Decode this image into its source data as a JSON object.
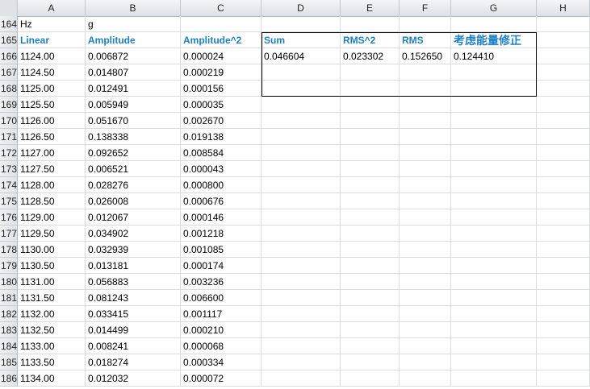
{
  "columns": [
    "A",
    "B",
    "C",
    "D",
    "E",
    "F",
    "G",
    "H"
  ],
  "rows": [
    {
      "num": "164",
      "a": "Hz",
      "b": "g",
      "c": "",
      "d": "",
      "e": "",
      "f": "",
      "g": "",
      "h": "",
      "hdr": false
    },
    {
      "num": "165",
      "a": "Linear",
      "b": "Amplitude",
      "c": "Amplitude^2",
      "d": "Sum",
      "e": "RMS^2",
      "f": "RMS",
      "g": "考虑能量修正",
      "h": "",
      "hdr": true
    },
    {
      "num": "166",
      "a": "1124.00",
      "b": "0.006872",
      "c": "0.000024",
      "d": "0.046604",
      "e": "0.023302",
      "f": "0.152650",
      "g": "0.124410",
      "h": "",
      "hdr": false
    },
    {
      "num": "167",
      "a": "1124.50",
      "b": "0.014807",
      "c": "0.000219",
      "d": "",
      "e": "",
      "f": "",
      "g": "",
      "h": "",
      "hdr": false
    },
    {
      "num": "168",
      "a": "1125.00",
      "b": "0.012491",
      "c": "0.000156",
      "d": "",
      "e": "",
      "f": "",
      "g": "",
      "h": "",
      "hdr": false
    },
    {
      "num": "169",
      "a": "1125.50",
      "b": "0.005949",
      "c": "0.000035",
      "d": "",
      "e": "",
      "f": "",
      "g": "",
      "h": "",
      "hdr": false
    },
    {
      "num": "170",
      "a": "1126.00",
      "b": "0.051670",
      "c": "0.002670",
      "d": "",
      "e": "",
      "f": "",
      "g": "",
      "h": "",
      "hdr": false
    },
    {
      "num": "171",
      "a": "1126.50",
      "b": "0.138338",
      "c": "0.019138",
      "d": "",
      "e": "",
      "f": "",
      "g": "",
      "h": "",
      "hdr": false
    },
    {
      "num": "172",
      "a": "1127.00",
      "b": "0.092652",
      "c": "0.008584",
      "d": "",
      "e": "",
      "f": "",
      "g": "",
      "h": "",
      "hdr": false
    },
    {
      "num": "173",
      "a": "1127.50",
      "b": "0.006521",
      "c": "0.000043",
      "d": "",
      "e": "",
      "f": "",
      "g": "",
      "h": "",
      "hdr": false
    },
    {
      "num": "174",
      "a": "1128.00",
      "b": "0.028276",
      "c": "0.000800",
      "d": "",
      "e": "",
      "f": "",
      "g": "",
      "h": "",
      "hdr": false
    },
    {
      "num": "175",
      "a": "1128.50",
      "b": "0.026008",
      "c": "0.000676",
      "d": "",
      "e": "",
      "f": "",
      "g": "",
      "h": "",
      "hdr": false
    },
    {
      "num": "176",
      "a": "1129.00",
      "b": "0.012067",
      "c": "0.000146",
      "d": "",
      "e": "",
      "f": "",
      "g": "",
      "h": "",
      "hdr": false
    },
    {
      "num": "177",
      "a": "1129.50",
      "b": "0.034902",
      "c": "0.001218",
      "d": "",
      "e": "",
      "f": "",
      "g": "",
      "h": "",
      "hdr": false
    },
    {
      "num": "178",
      "a": "1130.00",
      "b": "0.032939",
      "c": "0.001085",
      "d": "",
      "e": "",
      "f": "",
      "g": "",
      "h": "",
      "hdr": false
    },
    {
      "num": "179",
      "a": "1130.50",
      "b": "0.013181",
      "c": "0.000174",
      "d": "",
      "e": "",
      "f": "",
      "g": "",
      "h": "",
      "hdr": false
    },
    {
      "num": "180",
      "a": "1131.00",
      "b": "0.056883",
      "c": "0.003236",
      "d": "",
      "e": "",
      "f": "",
      "g": "",
      "h": "",
      "hdr": false
    },
    {
      "num": "181",
      "a": "1131.50",
      "b": "0.081243",
      "c": "0.006600",
      "d": "",
      "e": "",
      "f": "",
      "g": "",
      "h": "",
      "hdr": false
    },
    {
      "num": "182",
      "a": "1132.00",
      "b": "0.033415",
      "c": "0.001117",
      "d": "",
      "e": "",
      "f": "",
      "g": "",
      "h": "",
      "hdr": false
    },
    {
      "num": "183",
      "a": "1132.50",
      "b": "0.014499",
      "c": "0.000210",
      "d": "",
      "e": "",
      "f": "",
      "g": "",
      "h": "",
      "hdr": false
    },
    {
      "num": "184",
      "a": "1133.00",
      "b": "0.008241",
      "c": "0.000068",
      "d": "",
      "e": "",
      "f": "",
      "g": "",
      "h": "",
      "hdr": false
    },
    {
      "num": "185",
      "a": "1133.50",
      "b": "0.018274",
      "c": "0.000334",
      "d": "",
      "e": "",
      "f": "",
      "g": "",
      "h": "",
      "hdr": false
    },
    {
      "num": "186",
      "a": "1134.00",
      "b": "0.012032",
      "c": "0.000072",
      "d": "",
      "e": "",
      "f": "",
      "g": "",
      "h": "",
      "hdr": false
    }
  ],
  "colors": {
    "header_text": "#1f7fc0",
    "gridline": "#dadcdd",
    "header_bg": "#dfe3e8",
    "box_border": "#000000"
  }
}
